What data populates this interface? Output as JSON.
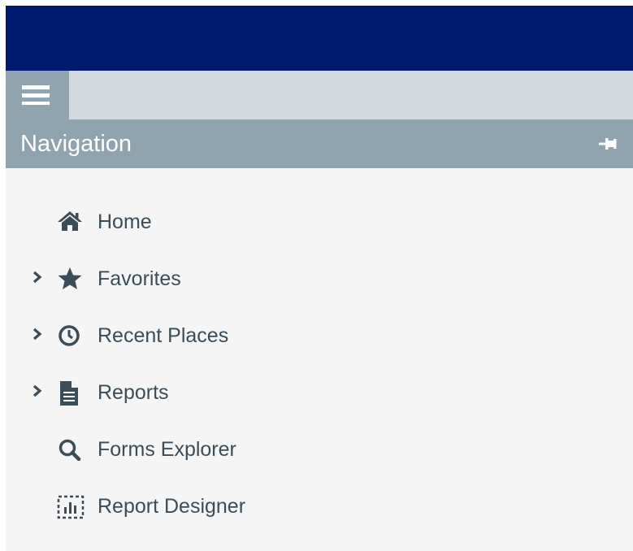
{
  "navigation": {
    "title": "Navigation",
    "items": [
      {
        "label": "Home",
        "icon": "home-icon",
        "expandable": false
      },
      {
        "label": "Favorites",
        "icon": "star-icon",
        "expandable": true
      },
      {
        "label": "Recent Places",
        "icon": "clock-icon",
        "expandable": true
      },
      {
        "label": "Reports",
        "icon": "document-icon",
        "expandable": true
      },
      {
        "label": "Forms Explorer",
        "icon": "search-icon",
        "expandable": false
      },
      {
        "label": "Report Designer",
        "icon": "report-designer-icon",
        "expandable": false
      }
    ]
  },
  "colors": {
    "topbar": "#001a6e",
    "toolbar": "#d3dbe1",
    "nav_header": "#8fa4ae",
    "panel_background": "#f5f5f5",
    "text": "#3b4d58"
  }
}
